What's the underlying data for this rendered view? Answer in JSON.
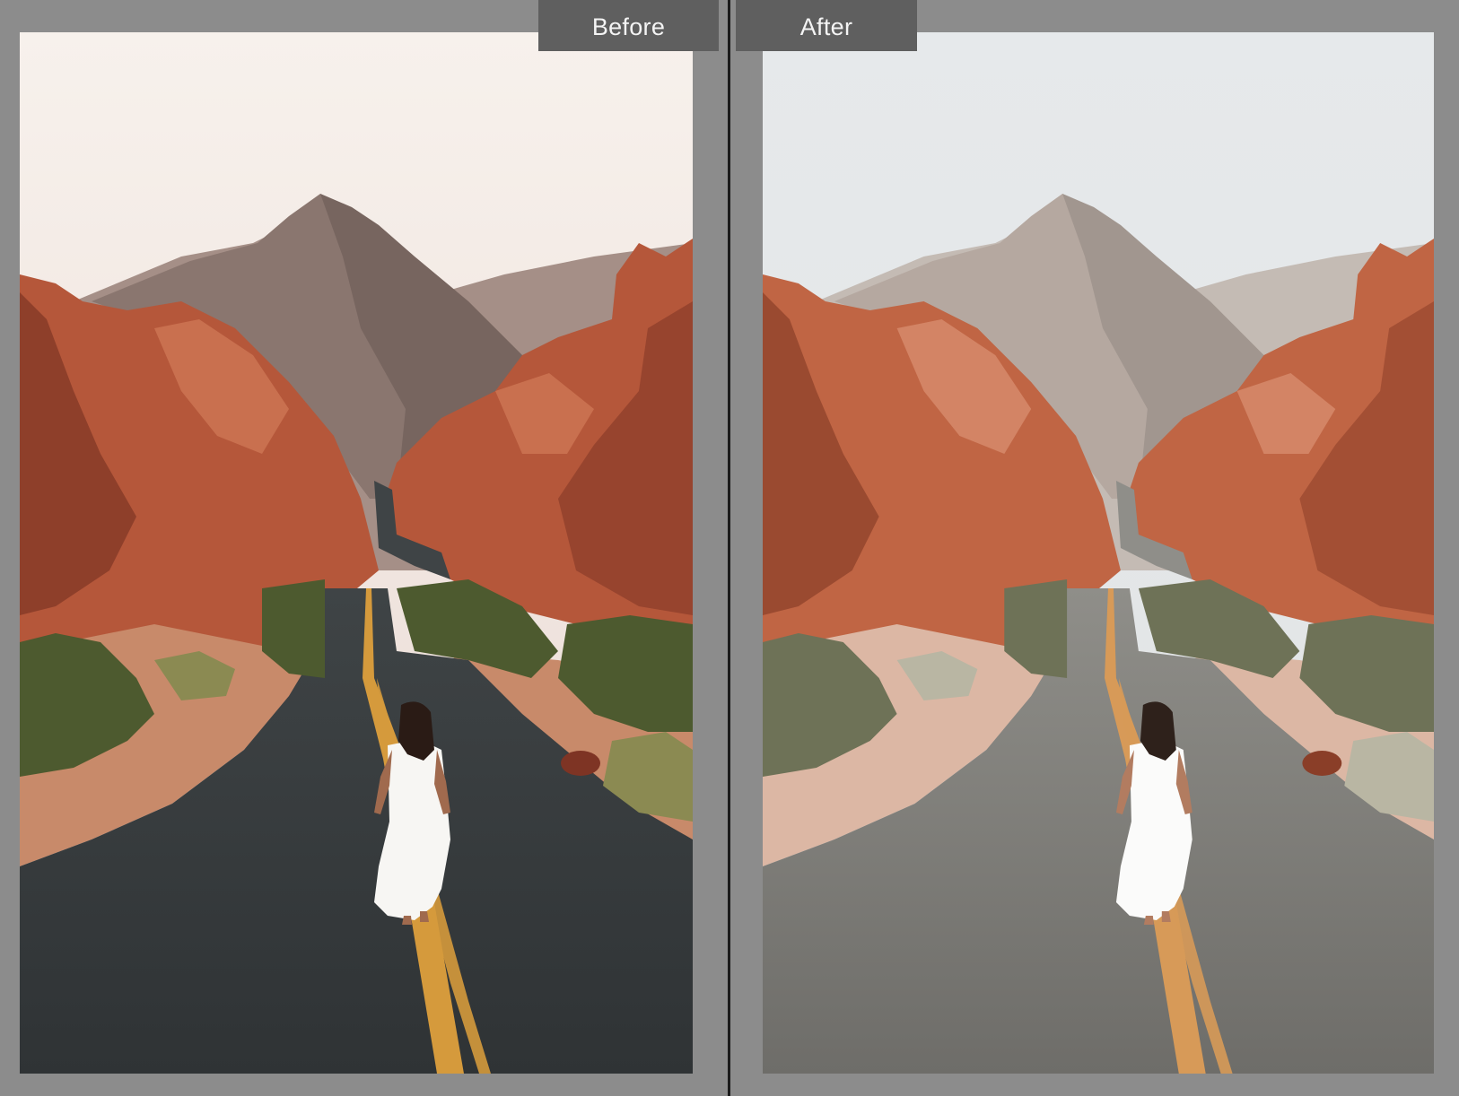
{
  "compare_view": {
    "before": {
      "label": "Before",
      "colors": {
        "sky_top": "#f7f1ec",
        "sky_bottom": "#e9d9d3",
        "mountain": "#8a766f",
        "mountain_shadow": "#6b5a55",
        "mountain_far": "#a58f87",
        "rock": "#b5573a",
        "rock_dark": "#7e3424",
        "rock_light": "#d27b58",
        "road": "#3f4446",
        "road_edge": "#2f3335",
        "line": "#d59a3c",
        "shoulder": "#c88a6a",
        "bush": "#4d5a2f",
        "bush_light": "#8b8a52",
        "dress": "#f7f6f3",
        "hair": "#2a1b15",
        "skin": "#a06a4e"
      }
    },
    "after": {
      "label": "After",
      "colors": {
        "sky_top": "#e6e9eb",
        "sky_bottom": "#e1e3e4",
        "mountain": "#b5a8a0",
        "mountain_shadow": "#948a83",
        "mountain_far": "#c4bbb4",
        "rock": "#c06544",
        "rock_dark": "#8a3e28",
        "rock_light": "#dc9274",
        "road": "#8f8e89",
        "road_edge": "#6e6d69",
        "line": "#d79a58",
        "shoulder": "#dcb7a4",
        "bush": "#6e7257",
        "bush_light": "#b9b6a3",
        "dress": "#fbfbfa",
        "hair": "#2e211b",
        "skin": "#b27c60"
      }
    }
  }
}
